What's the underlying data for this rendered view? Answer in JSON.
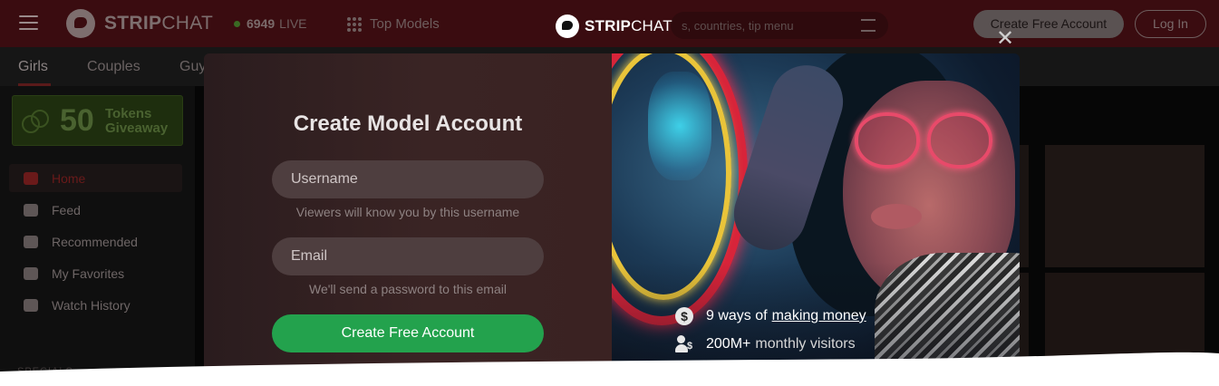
{
  "header": {
    "brand_bold": "STRIP",
    "brand_light": "CHAT",
    "live_count": "6949",
    "live_label": "LIVE",
    "top_models_label": "Top Models",
    "search_placeholder": "s, countries, tip menu",
    "create_account_label": "Create Free Account",
    "login_label": "Log In"
  },
  "categories": [
    "Girls",
    "Couples",
    "Guy"
  ],
  "sidebar": {
    "giveaway_amount": "50",
    "giveaway_line1": "Tokens",
    "giveaway_line2": "Giveaway",
    "items": [
      {
        "label": "Home",
        "icon": "home-icon"
      },
      {
        "label": "Feed",
        "icon": "feed-icon"
      },
      {
        "label": "Recommended",
        "icon": "thumbs-up-icon"
      },
      {
        "label": "My Favorites",
        "icon": "heart-icon"
      },
      {
        "label": "Watch History",
        "icon": "history-icon"
      }
    ],
    "specials_label": "SPECIALS"
  },
  "modal": {
    "brand_bold": "STRIP",
    "brand_light": "CHAT",
    "close_symbol": "✕",
    "title": "Create Model Account",
    "username_placeholder": "Username",
    "username_hint": "Viewers will know you by this username",
    "email_placeholder": "Email",
    "email_hint": "We'll send a password to this email",
    "submit_label": "Create Free Account",
    "perks": [
      {
        "icon": "dollar-icon",
        "glyph": "$",
        "text": "9 ways of",
        "link": "making money"
      },
      {
        "icon": "users-icon",
        "glyph": "$",
        "text": "200M+",
        "muted": "monthly visitors"
      }
    ]
  },
  "colors": {
    "accent_green": "#23a24d",
    "topbar": "#3a0c10",
    "modal_left": "#3a2424"
  }
}
